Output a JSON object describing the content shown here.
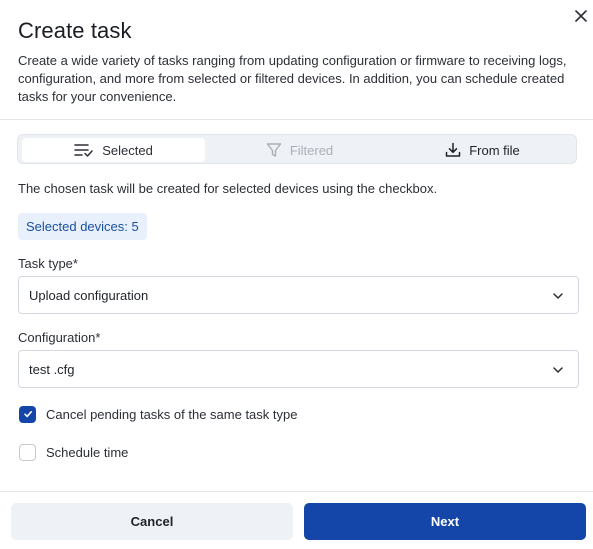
{
  "dialog": {
    "title": "Create task",
    "description": "Create a wide variety of tasks ranging from updating configuration or firmware to receiving logs, configuration, and more from selected or filtered devices. In addition, you can schedule created tasks for your convenience."
  },
  "tabs": [
    {
      "label": "Selected",
      "icon": "list-check-icon",
      "state": "active"
    },
    {
      "label": "Filtered",
      "icon": "filter-icon",
      "state": "disabled"
    },
    {
      "label": "From file",
      "icon": "download-icon",
      "state": "default"
    }
  ],
  "info_text": "The chosen task will be created for selected devices using the checkbox.",
  "selected_badge": "Selected devices: 5",
  "task_type": {
    "label": "Task type*",
    "value": "Upload configuration"
  },
  "configuration": {
    "label": "Configuration*",
    "value": "test .cfg"
  },
  "checkboxes": [
    {
      "label": "Cancel pending tasks of the same task type",
      "checked": true
    },
    {
      "label": "Schedule time",
      "checked": false
    }
  ],
  "footer": {
    "cancel_label": "Cancel",
    "next_label": "Next"
  },
  "colors": {
    "primary": "#1346a8",
    "badge_bg": "#e8f0fb",
    "badge_text": "#1a4f9e",
    "segment_bg": "#eef1f5"
  }
}
